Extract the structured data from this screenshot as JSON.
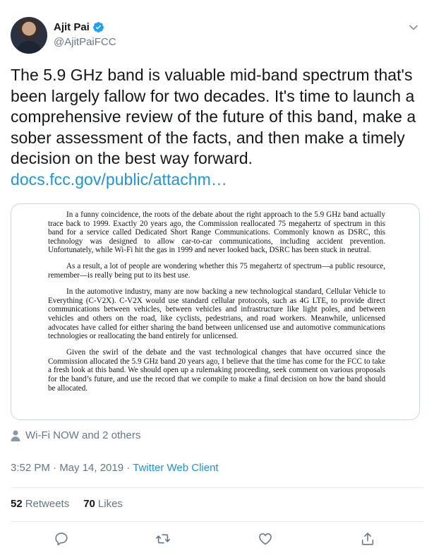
{
  "author": {
    "name": "Ajit Pai",
    "handle": "@AjitPaiFCC",
    "verified": true,
    "avatar_icon": "profile-photo"
  },
  "tweet": {
    "text": "The 5.9 GHz band is valuable mid-band spectrum that's been largely fallow for two decades. It's time to launch a comprehensive review of the future of this band, make a sober assessment of the facts, and then make a timely decision on the best way forward. ",
    "link_text": "docs.fcc.gov/public/attachm…"
  },
  "document": {
    "paragraphs": [
      "In a funny coincidence, the roots of the debate about the right approach to the 5.9 GHz band actually trace back to 1999. Exactly 20 years ago, the Commission reallocated 75 megahertz of spectrum in this band for a service called Dedicated Short Range Communications. Commonly known as DSRC, this technology was designed to allow car-to-car communications, including accident prevention. Unfortunately, while Wi-Fi hit the gas in 1999 and never looked back, DSRC has been stuck in neutral.",
      "As a result, a lot of people are wondering whether this 75 megahertz of spectrum—a public resource, remember—is really being put to its best use.",
      "In the automotive industry, many are now backing a new technological standard, Cellular Vehicle to Everything (C-V2X). C-V2X would use standard cellular protocols, such as 4G LTE, to provide direct communications between vehicles, between vehicles and infrastructure like light poles, and between vehicles and others on the road, like cyclists, pedestrians, and road workers. Meanwhile, unlicensed advocates have called for either sharing the band between unlicensed use and automotive communications technologies or reallocating the band entirely for unlicensed.",
      "Given the swirl of the debate and the vast technological changes that have occurred since the Commission allocated the 5.9 GHz band 20 years ago, I believe that the time has come for the FCC to take a fresh look at this band. We should open up a rulemaking proceeding, seek comment on various proposals for the band’s future, and use the record that we compile to make a final decision on how the band should be allocated."
    ]
  },
  "tagged": {
    "text": "Wi-Fi NOW and 2 others",
    "icon": "person-icon"
  },
  "meta": {
    "timestamp": "3:52 PM · May 14, 2019 · ",
    "client": "Twitter Web Client"
  },
  "stats": {
    "retweets_count": "52",
    "retweets_label": "Retweets",
    "likes_count": "70",
    "likes_label": "Likes"
  },
  "actions": [
    "reply-icon",
    "retweet-icon",
    "like-icon",
    "share-icon"
  ],
  "colors": {
    "link": "#1b95e0",
    "muted": "#657786",
    "text": "#14171a",
    "verified": "#1da1f2"
  }
}
